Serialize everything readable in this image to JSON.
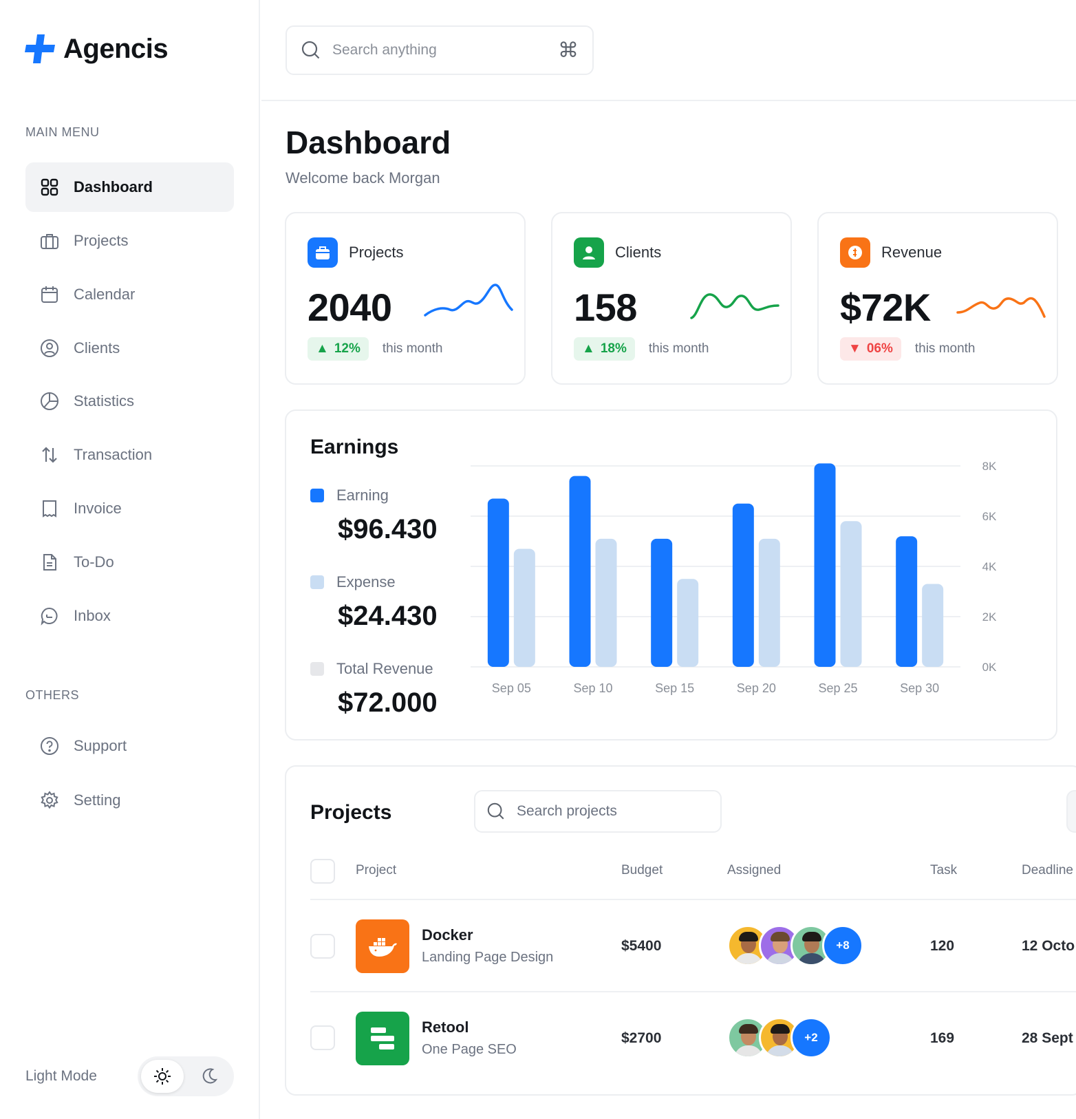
{
  "brand": {
    "name": "Agencis",
    "accent": "#1677ff"
  },
  "sidebar": {
    "main_menu_title": "MAIN MENU",
    "main_items": [
      {
        "label": "Dashboard",
        "icon": "grid-icon",
        "active": true
      },
      {
        "label": "Projects",
        "icon": "briefcase-icon"
      },
      {
        "label": "Calendar",
        "icon": "calendar-icon"
      },
      {
        "label": "Clients",
        "icon": "user-circle-icon"
      },
      {
        "label": "Statistics",
        "icon": "pie-chart-icon"
      },
      {
        "label": "Transaction",
        "icon": "arrows-up-down-icon"
      },
      {
        "label": "Invoice",
        "icon": "invoice-icon"
      },
      {
        "label": "To-Do",
        "icon": "document-icon"
      },
      {
        "label": "Inbox",
        "icon": "chat-icon"
      }
    ],
    "others_title": "OTHERS",
    "other_items": [
      {
        "label": "Support",
        "icon": "help-circle-icon"
      },
      {
        "label": "Setting",
        "icon": "gear-icon"
      }
    ],
    "theme_label": "Light Mode"
  },
  "search": {
    "placeholder": "Search anything",
    "shortcut": "⌘"
  },
  "header": {
    "title": "Dashboard",
    "subtitle": "Welcome back Morgan"
  },
  "stats": [
    {
      "label": "Projects",
      "value": "2040",
      "delta": "12%",
      "trend": "up",
      "period": "this month",
      "color": "#1677ff"
    },
    {
      "label": "Clients",
      "value": "158",
      "delta": "18%",
      "trend": "up",
      "period": "this month",
      "color": "#16a34a"
    },
    {
      "label": "Revenue",
      "value": "$72K",
      "delta": "06%",
      "trend": "down",
      "period": "this month",
      "color": "#f97316"
    }
  ],
  "earnings": {
    "title": "Earnings",
    "legend": [
      {
        "name": "Earning",
        "value": "$96.430",
        "color": "#1677ff"
      },
      {
        "name": "Expense",
        "value": "$24.430",
        "color": "#c9ddf3"
      },
      {
        "name": "Total Revenue",
        "value": "$72.000",
        "color": "#e6e7ea"
      }
    ]
  },
  "chart_data": {
    "type": "bar",
    "categories": [
      "Sep 05",
      "Sep 10",
      "Sep 15",
      "Sep 20",
      "Sep 25",
      "Sep 30"
    ],
    "series": [
      {
        "name": "Earning",
        "values": [
          6700,
          7600,
          5100,
          6500,
          8100,
          5200
        ],
        "color": "#1677ff"
      },
      {
        "name": "Expense",
        "values": [
          4700,
          5100,
          3500,
          5100,
          5800,
          3300
        ],
        "color": "#c9ddf3"
      }
    ],
    "y_ticks": [
      "0K",
      "2K",
      "4K",
      "6K",
      "8K"
    ],
    "ylim": [
      0,
      8000
    ],
    "y_axis_side": "right",
    "grid": true
  },
  "projects": {
    "title": "Projects",
    "search_placeholder": "Search projects",
    "columns": [
      "Project",
      "Budget",
      "Assigned",
      "Task",
      "Deadline"
    ],
    "rows": [
      {
        "name": "Docker",
        "desc": "Landing Page Design",
        "budget": "$5400",
        "extra_assigned": "+8",
        "tasks": "120",
        "deadline": "12 Octo",
        "logo_color": "#f97316",
        "logo_icon": "docker-whale-icon"
      },
      {
        "name": "Retool",
        "desc": "One Page SEO",
        "budget": "$2700",
        "extra_assigned": "+2",
        "tasks": "169",
        "deadline": "28 Sept",
        "logo_color": "#16a34a",
        "logo_icon": "retool-icon"
      }
    ]
  }
}
